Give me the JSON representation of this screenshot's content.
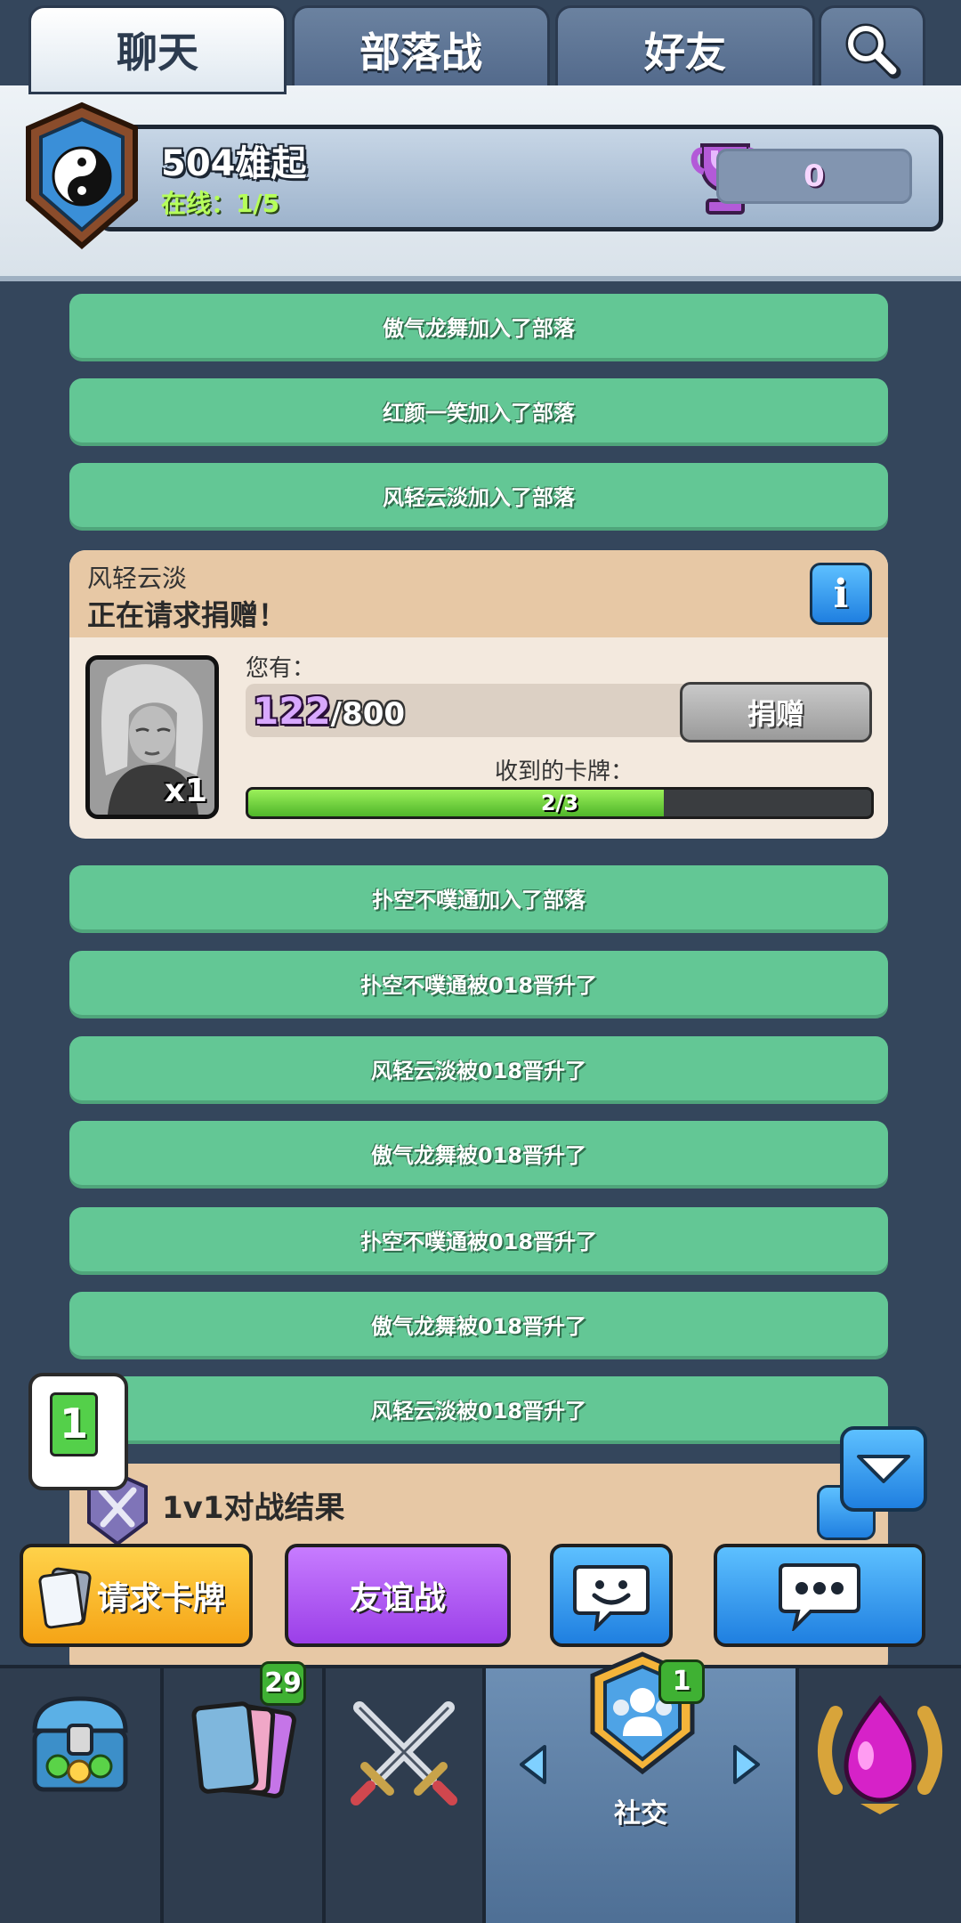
{
  "tabs": [
    {
      "label": "聊天",
      "active": true
    },
    {
      "label": "部落战",
      "active": false
    },
    {
      "label": "好友",
      "active": false
    }
  ],
  "clan": {
    "name": "504雄起",
    "online": "在线：1/5",
    "trophies": "0"
  },
  "feed": {
    "top_messages": [
      "傲气龙舞加入了部落",
      "红颜一笑加入了部落",
      "风轻云淡加入了部落"
    ],
    "donation": {
      "user": "风轻云淡",
      "request_text": "正在请求捐赠！",
      "you_have_label": "您有：",
      "owned": "122",
      "required": "/800",
      "donate_label": "捐赠",
      "received_label": "收到的卡牌：",
      "received_text": "2/3",
      "received_fraction": 0.6667,
      "card_count": "x1"
    },
    "bottom_messages": [
      "扑空不噗通加入了部落",
      "扑空不噗通被018晋升了",
      "风轻云淡被018晋升了",
      "傲气龙舞被018晋升了",
      "扑空不噗通被018晋升了",
      "傲气龙舞被018晋升了",
      "风轻云淡被018晋升了"
    ],
    "battle_title": "1v1对战结果"
  },
  "notification_count": "1",
  "actions": {
    "request_cards": "请求卡牌",
    "friendly_battle": "友谊战"
  },
  "bottom_nav": {
    "cards_badge": "29",
    "social_badge": "1",
    "social_label": "社交"
  },
  "colors": {
    "background": "#34465c",
    "system_message": "#63c795",
    "donation_header": "#e7c8a5",
    "progress_green": "#6ad03a",
    "request_button": "#f5b52c",
    "friendly_button": "#b05cf5",
    "blue_button": "#2f92ee"
  }
}
